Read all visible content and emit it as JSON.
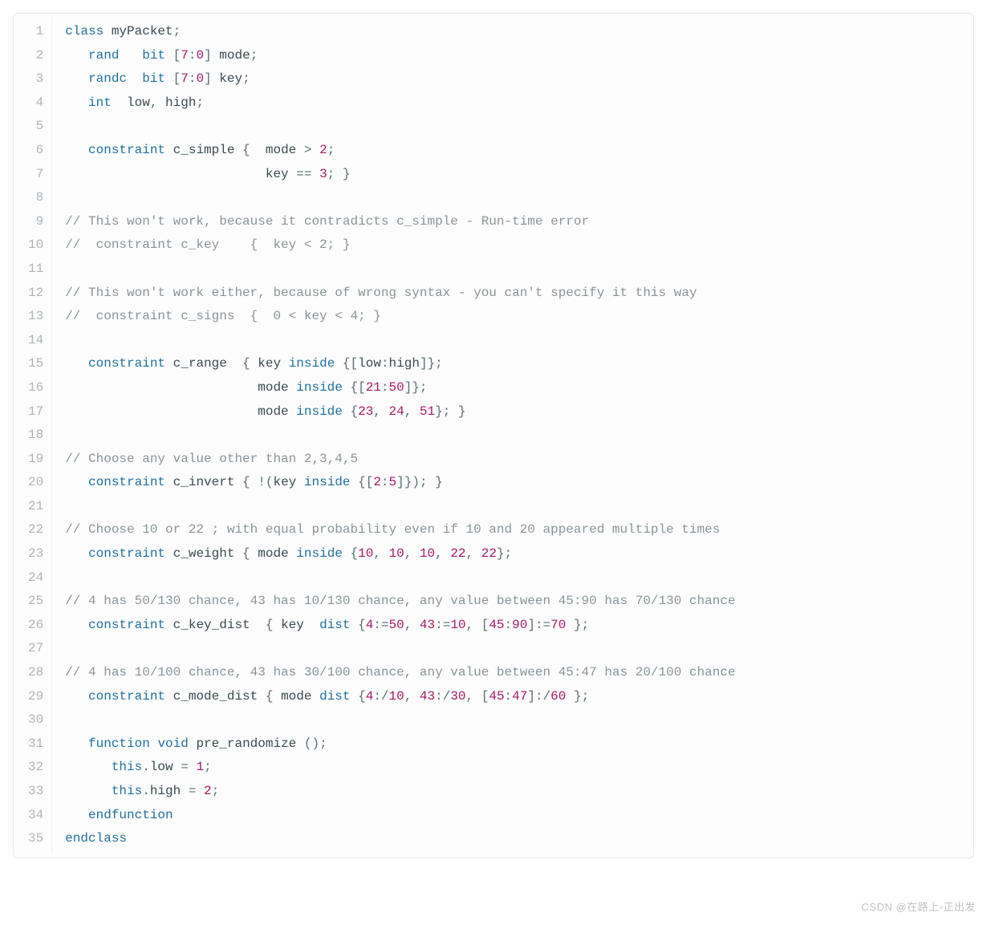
{
  "watermark": "CSDN @在路上-正出发",
  "lines": [
    [
      {
        "t": "class ",
        "c": "kw"
      },
      {
        "t": "myPacket",
        "c": "ident"
      },
      {
        "t": ";",
        "c": "pun"
      }
    ],
    [
      {
        "t": "   "
      },
      {
        "t": "rand",
        "c": "kw"
      },
      {
        "t": "   "
      },
      {
        "t": "bit",
        "c": "type"
      },
      {
        "t": " ["
      },
      {
        "t": "7",
        "c": "num"
      },
      {
        "t": ":"
      },
      {
        "t": "0",
        "c": "num"
      },
      {
        "t": "] "
      },
      {
        "t": "mode",
        "c": "ident"
      },
      {
        "t": ";",
        "c": "pun"
      }
    ],
    [
      {
        "t": "   "
      },
      {
        "t": "randc",
        "c": "kw"
      },
      {
        "t": "  "
      },
      {
        "t": "bit",
        "c": "type"
      },
      {
        "t": " ["
      },
      {
        "t": "7",
        "c": "num"
      },
      {
        "t": ":"
      },
      {
        "t": "0",
        "c": "num"
      },
      {
        "t": "] "
      },
      {
        "t": "key",
        "c": "ident"
      },
      {
        "t": ";",
        "c": "pun"
      }
    ],
    [
      {
        "t": "   "
      },
      {
        "t": "int",
        "c": "kw"
      },
      {
        "t": "  "
      },
      {
        "t": "low",
        "c": "ident"
      },
      {
        "t": ", "
      },
      {
        "t": "high",
        "c": "ident"
      },
      {
        "t": ";",
        "c": "pun"
      }
    ],
    [
      {
        "t": " "
      }
    ],
    [
      {
        "t": "   "
      },
      {
        "t": "constraint",
        "c": "kw"
      },
      {
        "t": " "
      },
      {
        "t": "c_simple",
        "c": "ident"
      },
      {
        "t": " {  "
      },
      {
        "t": "mode",
        "c": "ident"
      },
      {
        "t": " > "
      },
      {
        "t": "2",
        "c": "num"
      },
      {
        "t": ";",
        "c": "pun"
      }
    ],
    [
      {
        "t": "                          "
      },
      {
        "t": "key",
        "c": "ident"
      },
      {
        "t": " == "
      },
      {
        "t": "3",
        "c": "num"
      },
      {
        "t": "; }",
        "c": "pun"
      }
    ],
    [
      {
        "t": " "
      }
    ],
    [
      {
        "t": "// This won't work, because it contradicts c_simple - Run-time error",
        "c": "cmt"
      }
    ],
    [
      {
        "t": "//  constraint c_key    {  key < 2; }",
        "c": "cmt"
      }
    ],
    [
      {
        "t": " "
      }
    ],
    [
      {
        "t": "// This won't work either, because of wrong syntax - you can't specify it this way",
        "c": "cmt"
      }
    ],
    [
      {
        "t": "//  constraint c_signs  {  0 < key < 4; }",
        "c": "cmt"
      }
    ],
    [
      {
        "t": " "
      }
    ],
    [
      {
        "t": "   "
      },
      {
        "t": "constraint",
        "c": "kw"
      },
      {
        "t": " "
      },
      {
        "t": "c_range",
        "c": "ident"
      },
      {
        "t": "  { "
      },
      {
        "t": "key",
        "c": "ident"
      },
      {
        "t": " "
      },
      {
        "t": "inside",
        "c": "kw"
      },
      {
        "t": " {["
      },
      {
        "t": "low",
        "c": "ident"
      },
      {
        "t": ":"
      },
      {
        "t": "high",
        "c": "ident"
      },
      {
        "t": "]};",
        "c": "pun"
      }
    ],
    [
      {
        "t": "                         "
      },
      {
        "t": "mode",
        "c": "ident"
      },
      {
        "t": " "
      },
      {
        "t": "inside",
        "c": "kw"
      },
      {
        "t": " {["
      },
      {
        "t": "21",
        "c": "num"
      },
      {
        "t": ":"
      },
      {
        "t": "50",
        "c": "num"
      },
      {
        "t": "]};",
        "c": "pun"
      }
    ],
    [
      {
        "t": "                         "
      },
      {
        "t": "mode",
        "c": "ident"
      },
      {
        "t": " "
      },
      {
        "t": "inside",
        "c": "kw"
      },
      {
        "t": " {"
      },
      {
        "t": "23",
        "c": "num"
      },
      {
        "t": ", "
      },
      {
        "t": "24",
        "c": "num"
      },
      {
        "t": ", "
      },
      {
        "t": "51",
        "c": "num"
      },
      {
        "t": "}; }",
        "c": "pun"
      }
    ],
    [
      {
        "t": " "
      }
    ],
    [
      {
        "t": "// Choose any value other than 2,3,4,5",
        "c": "cmt"
      }
    ],
    [
      {
        "t": "   "
      },
      {
        "t": "constraint",
        "c": "kw"
      },
      {
        "t": " "
      },
      {
        "t": "c_invert",
        "c": "ident"
      },
      {
        "t": " { !("
      },
      {
        "t": "key",
        "c": "ident"
      },
      {
        "t": " "
      },
      {
        "t": "inside",
        "c": "kw"
      },
      {
        "t": " {["
      },
      {
        "t": "2",
        "c": "num"
      },
      {
        "t": ":"
      },
      {
        "t": "5",
        "c": "num"
      },
      {
        "t": "]}); }",
        "c": "pun"
      }
    ],
    [
      {
        "t": " "
      }
    ],
    [
      {
        "t": "// Choose 10 or 22 ; with equal probability even if 10 and 20 appeared multiple times",
        "c": "cmt"
      }
    ],
    [
      {
        "t": "   "
      },
      {
        "t": "constraint",
        "c": "kw"
      },
      {
        "t": " "
      },
      {
        "t": "c_weight",
        "c": "ident"
      },
      {
        "t": " { "
      },
      {
        "t": "mode",
        "c": "ident"
      },
      {
        "t": " "
      },
      {
        "t": "inside",
        "c": "kw"
      },
      {
        "t": " {"
      },
      {
        "t": "10",
        "c": "num"
      },
      {
        "t": ", "
      },
      {
        "t": "10",
        "c": "num"
      },
      {
        "t": ", "
      },
      {
        "t": "10",
        "c": "num"
      },
      {
        "t": ", "
      },
      {
        "t": "22",
        "c": "num"
      },
      {
        "t": ", "
      },
      {
        "t": "22",
        "c": "num"
      },
      {
        "t": "};",
        "c": "pun"
      }
    ],
    [
      {
        "t": " "
      }
    ],
    [
      {
        "t": "// 4 has 50/130 chance, 43 has 10/130 chance, any value between 45:90 has 70/130 chance",
        "c": "cmt"
      }
    ],
    [
      {
        "t": "   "
      },
      {
        "t": "constraint",
        "c": "kw"
      },
      {
        "t": " "
      },
      {
        "t": "c_key_dist",
        "c": "ident"
      },
      {
        "t": "  { "
      },
      {
        "t": "key",
        "c": "ident"
      },
      {
        "t": "  "
      },
      {
        "t": "dist",
        "c": "kw"
      },
      {
        "t": " {"
      },
      {
        "t": "4",
        "c": "num"
      },
      {
        "t": ":="
      },
      {
        "t": "50",
        "c": "num"
      },
      {
        "t": ", "
      },
      {
        "t": "43",
        "c": "num"
      },
      {
        "t": ":="
      },
      {
        "t": "10",
        "c": "num"
      },
      {
        "t": ", ["
      },
      {
        "t": "45",
        "c": "num"
      },
      {
        "t": ":"
      },
      {
        "t": "90",
        "c": "num"
      },
      {
        "t": "]:="
      },
      {
        "t": "70",
        "c": "num"
      },
      {
        "t": " };",
        "c": "pun"
      }
    ],
    [
      {
        "t": " "
      }
    ],
    [
      {
        "t": "// 4 has 10/100 chance, 43 has 30/100 chance, any value between 45:47 has 20/100 chance",
        "c": "cmt"
      }
    ],
    [
      {
        "t": "   "
      },
      {
        "t": "constraint",
        "c": "kw"
      },
      {
        "t": " "
      },
      {
        "t": "c_mode_dist",
        "c": "ident"
      },
      {
        "t": " { "
      },
      {
        "t": "mode",
        "c": "ident"
      },
      {
        "t": " "
      },
      {
        "t": "dist",
        "c": "kw"
      },
      {
        "t": " {"
      },
      {
        "t": "4",
        "c": "num"
      },
      {
        "t": ":/"
      },
      {
        "t": "10",
        "c": "num"
      },
      {
        "t": ", "
      },
      {
        "t": "43",
        "c": "num"
      },
      {
        "t": ":/"
      },
      {
        "t": "30",
        "c": "num"
      },
      {
        "t": ", ["
      },
      {
        "t": "45",
        "c": "num"
      },
      {
        "t": ":"
      },
      {
        "t": "47",
        "c": "num"
      },
      {
        "t": "]:/"
      },
      {
        "t": "60",
        "c": "num"
      },
      {
        "t": " };",
        "c": "pun"
      }
    ],
    [
      {
        "t": " "
      }
    ],
    [
      {
        "t": "   "
      },
      {
        "t": "function",
        "c": "kw"
      },
      {
        "t": " "
      },
      {
        "t": "void",
        "c": "kw"
      },
      {
        "t": " "
      },
      {
        "t": "pre_randomize",
        "c": "fn"
      },
      {
        "t": " ();",
        "c": "pun"
      }
    ],
    [
      {
        "t": "      "
      },
      {
        "t": "this",
        "c": "kw"
      },
      {
        "t": "."
      },
      {
        "t": "low",
        "c": "ident"
      },
      {
        "t": " = "
      },
      {
        "t": "1",
        "c": "num"
      },
      {
        "t": ";",
        "c": "pun"
      }
    ],
    [
      {
        "t": "      "
      },
      {
        "t": "this",
        "c": "kw"
      },
      {
        "t": "."
      },
      {
        "t": "high",
        "c": "ident"
      },
      {
        "t": " = "
      },
      {
        "t": "2",
        "c": "num"
      },
      {
        "t": ";",
        "c": "pun"
      }
    ],
    [
      {
        "t": "   "
      },
      {
        "t": "endfunction",
        "c": "kw"
      }
    ],
    [
      {
        "t": "endclass",
        "c": "kw"
      }
    ]
  ]
}
